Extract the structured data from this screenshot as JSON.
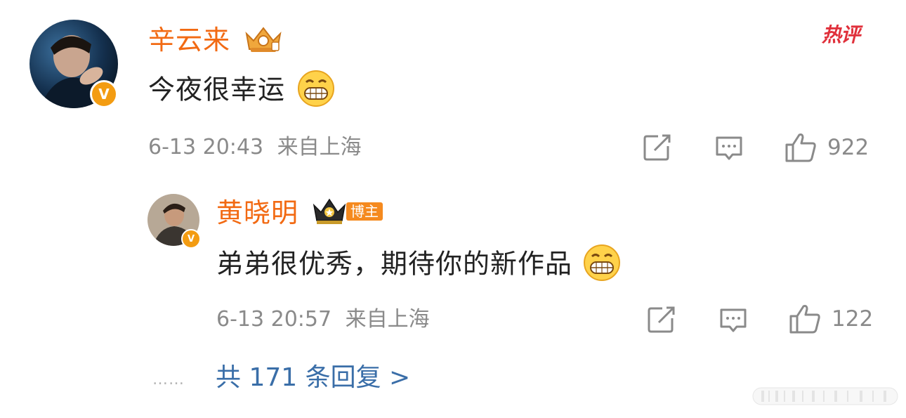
{
  "comment": {
    "username": "辛云来",
    "text": "今夜很幸运",
    "time": "6-13 20:43",
    "location": "来自上海",
    "hot_label": "热评",
    "likes": "922",
    "actions": [
      "share-icon",
      "reply-icon",
      "like-icon"
    ]
  },
  "reply": {
    "username": "黄晓明",
    "badge": "博主",
    "text": "弟弟很优秀，期待你的新作品",
    "time": "6-13 20:57",
    "location": "来自上海",
    "likes": "122",
    "actions": [
      "share-icon",
      "reply-icon",
      "like-icon"
    ]
  },
  "replies_link": {
    "dots": "……",
    "label": "共 171 条回复 >"
  },
  "colors": {
    "username": "#f26a13",
    "text": "#222222",
    "meta": "#8a8a8a",
    "link": "#3a6ea8",
    "hot": "#e0303b",
    "verified": "#f39c12"
  }
}
